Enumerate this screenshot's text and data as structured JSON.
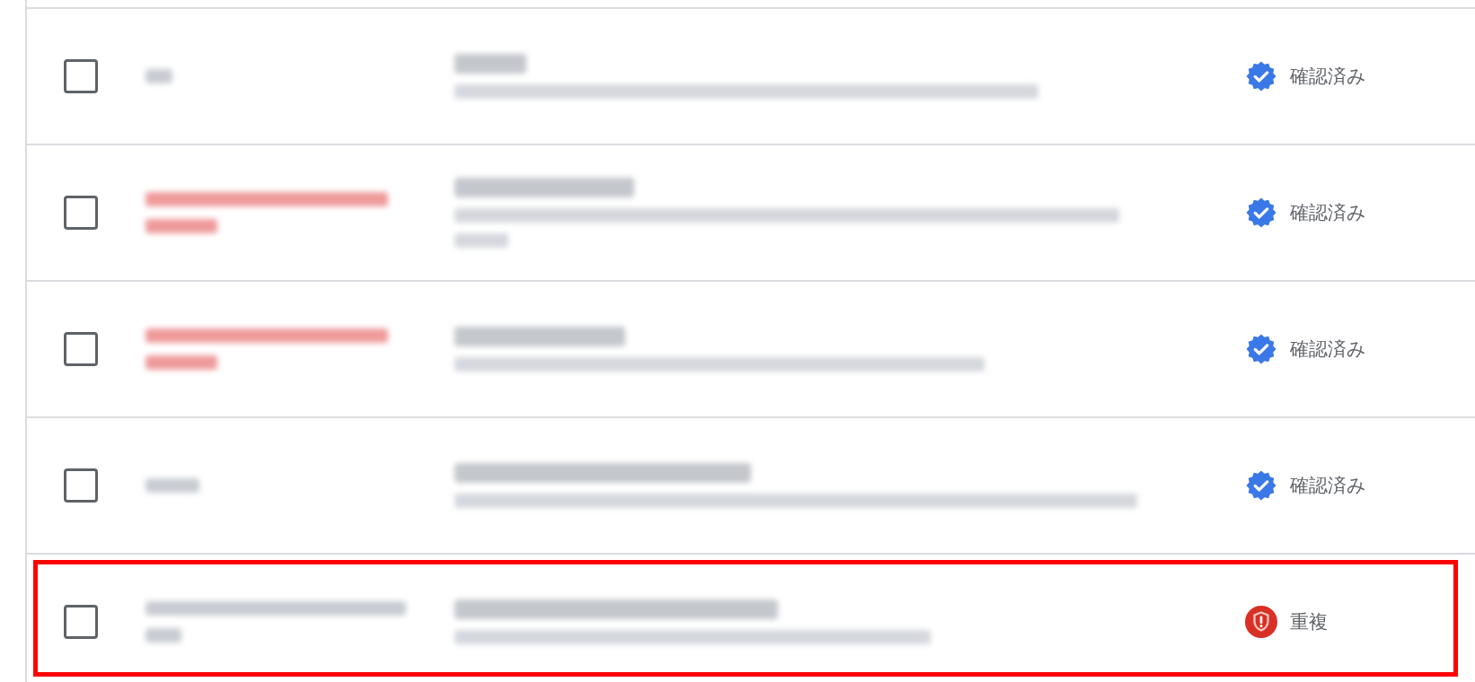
{
  "rows": [
    {
      "checked": false,
      "column_1": {
        "color": "#c8ccd2"
      },
      "status": {
        "kind": "verified",
        "label": "確認済み"
      },
      "highlighted": false
    },
    {
      "checked": false,
      "column_1": {
        "color": "#ef9a9a"
      },
      "status": {
        "kind": "verified",
        "label": "確認済み"
      },
      "highlighted": false
    },
    {
      "checked": false,
      "column_1": {
        "color": "#ef9a9a"
      },
      "status": {
        "kind": "verified",
        "label": "確認済み"
      },
      "highlighted": false
    },
    {
      "checked": false,
      "column_1": {
        "color": "#c8ccd2"
      },
      "status": {
        "kind": "verified",
        "label": "確認済み"
      },
      "highlighted": false
    },
    {
      "checked": false,
      "column_1": {
        "color": "#c8ccd2"
      },
      "status": {
        "kind": "duplicate",
        "label": "重複"
      },
      "highlighted": true
    }
  ]
}
